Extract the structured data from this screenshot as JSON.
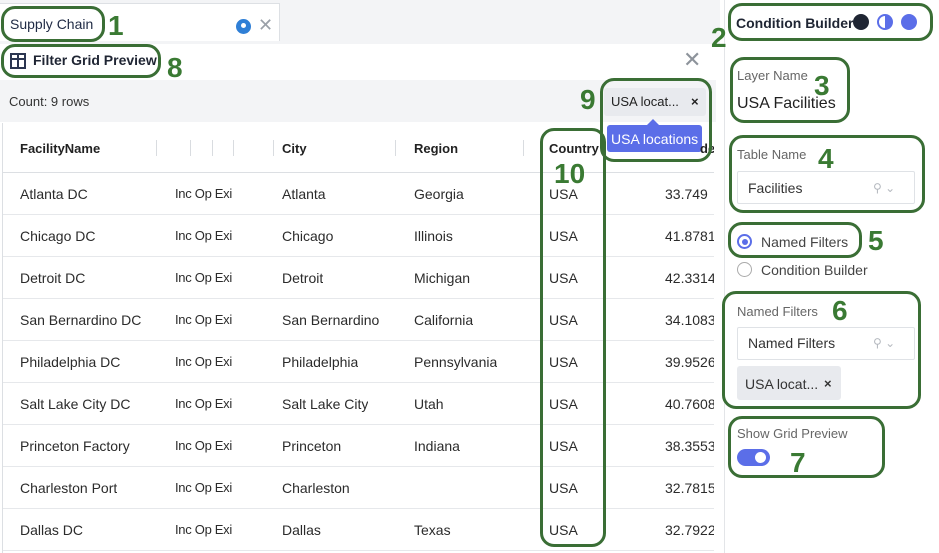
{
  "tab": {
    "title": "Supply Chain",
    "pin_icon": "location-pin-icon",
    "close_icon": "close-icon"
  },
  "panel": {
    "title": "Filter Grid Preview",
    "icon": "filter-grid-icon",
    "close_icon": "close-icon",
    "count_text": "Count: 9 rows",
    "filter_chip": {
      "label": "USA locat...",
      "remove": "×"
    },
    "tooltip": "USA locations"
  },
  "grid": {
    "columns": [
      "FacilityName",
      "",
      "",
      "",
      "City",
      "Region",
      "Country",
      "de"
    ],
    "rows": [
      {
        "name": "Atlanta DC",
        "abbr": "Inc Op Exi",
        "city": "Atlanta",
        "region": "Georgia",
        "country": "USA",
        "lat": "33.749"
      },
      {
        "name": "Chicago DC",
        "abbr": "Inc Op Exi",
        "city": "Chicago",
        "region": "Illinois",
        "country": "USA",
        "lat": "41.8781"
      },
      {
        "name": "Detroit DC",
        "abbr": "Inc Op Exi",
        "city": "Detroit",
        "region": "Michigan",
        "country": "USA",
        "lat": "42.3314"
      },
      {
        "name": "San Bernardino DC",
        "abbr": "Inc Op Exi",
        "city": "San Bernardino",
        "region": "California",
        "country": "USA",
        "lat": "34.1083"
      },
      {
        "name": "Philadelphia DC",
        "abbr": "Inc Op Exi",
        "city": "Philadelphia",
        "region": "Pennsylvania",
        "country": "USA",
        "lat": "39.9526"
      },
      {
        "name": "Salt Lake City DC",
        "abbr": "Inc Op Exi",
        "city": "Salt Lake City",
        "region": "Utah",
        "country": "USA",
        "lat": "40.7608"
      },
      {
        "name": "Princeton Factory",
        "abbr": "Inc Op Exi",
        "city": "Princeton",
        "region": "Indiana",
        "country": "USA",
        "lat": "38.3553"
      },
      {
        "name": "Charleston Port",
        "abbr": "Inc Op Exi",
        "city": "Charleston",
        "region": "",
        "country": "USA",
        "lat": "32.7815"
      },
      {
        "name": "Dallas DC",
        "abbr": "Inc Op Exi",
        "city": "Dallas",
        "region": "Texas",
        "country": "USA",
        "lat": "32.7922"
      }
    ]
  },
  "right_panel": {
    "title": "Condition Builder",
    "icons": [
      "user-icon",
      "contrast-icon",
      "settings-icon"
    ],
    "layer_name_label": "Layer Name",
    "layer_name_value": "USA Facilities",
    "table_name_label": "Table Name",
    "table_name_value": "Facilities",
    "radio_named": "Named Filters",
    "radio_condition": "Condition Builder",
    "named_filters_label": "Named Filters",
    "named_filters_placeholder": "Named Filters",
    "named_chip": "USA locat...",
    "named_chip_remove": "×",
    "show_grid_label": "Show Grid Preview",
    "show_grid_on": true
  },
  "annotations": [
    "1",
    "2",
    "3",
    "4",
    "5",
    "6",
    "7",
    "8",
    "9",
    "10"
  ],
  "colors": {
    "accent": "#5b6ee8",
    "annotation": "#3a6e35",
    "pin": "#2f7fd6"
  }
}
